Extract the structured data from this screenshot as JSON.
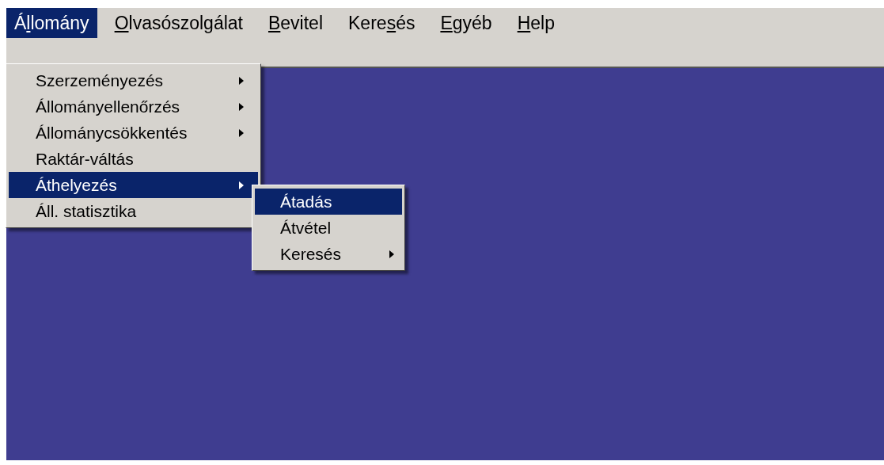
{
  "menu_bar": [
    {
      "before": "Á",
      "key": "l",
      "after": "lomány",
      "selected": true
    },
    {
      "key": "O",
      "after": "lvasószolgálat",
      "selected": false
    },
    {
      "key": "B",
      "after": "evitel",
      "selected": false
    },
    {
      "before": "Kere",
      "key": "s",
      "after": "és",
      "selected": false
    },
    {
      "key": "E",
      "after": "gyéb",
      "selected": false
    },
    {
      "key": "H",
      "after": "elp",
      "selected": false
    }
  ],
  "dropdown": {
    "items": [
      {
        "label": "Szerzeményezés",
        "submenu": true,
        "selected": false
      },
      {
        "label": "Állományellenőrzés",
        "submenu": true,
        "selected": false
      },
      {
        "label": "Állománycsökkentés",
        "submenu": true,
        "selected": false
      },
      {
        "label": "Raktár-váltás",
        "submenu": false,
        "selected": false
      },
      {
        "label": "Áthelyezés",
        "submenu": true,
        "selected": true
      },
      {
        "label": "Áll. statisztika",
        "submenu": false,
        "selected": false
      }
    ]
  },
  "submenu": {
    "items": [
      {
        "label": "Átadás",
        "submenu": false,
        "selected": true
      },
      {
        "label": "Átvétel",
        "submenu": false,
        "selected": false
      },
      {
        "label": "Keresés",
        "submenu": true,
        "selected": false
      }
    ]
  }
}
